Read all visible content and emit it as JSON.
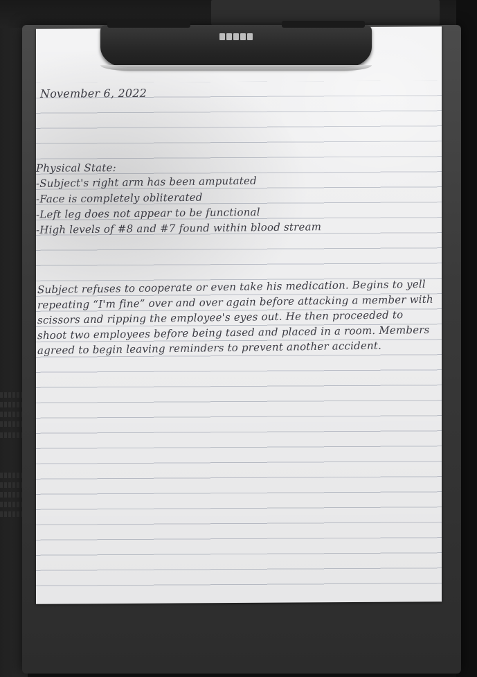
{
  "note": {
    "date": "November 6, 2022",
    "physical_heading": "Physical State:",
    "physical_items": [
      "-Subject's right arm has been amputated",
      "-Face is completely obliterated",
      "-Left leg does not appear to be functional",
      "-High levels of #8 and #7 found within blood stream"
    ],
    "paragraph_lines": [
      "Subject refuses to cooperate or even take his medication. Begins to yell",
      "repeating “I'm fine” over and over again before attacking a member with",
      "scissors and ripping the employee's eyes out. He then proceeded to",
      "shoot two employees before being tased and placed in a room. Members",
      "agreed to begin leaving reminders to prevent another accident."
    ]
  },
  "colors": {
    "ink": "#3c3c44",
    "paper": "#f3f3f4",
    "clipboard": "#3a3a3a",
    "rule_line": "#bfc3cc"
  },
  "icons": {
    "clip_logo": "clipboard-brand-mark"
  }
}
